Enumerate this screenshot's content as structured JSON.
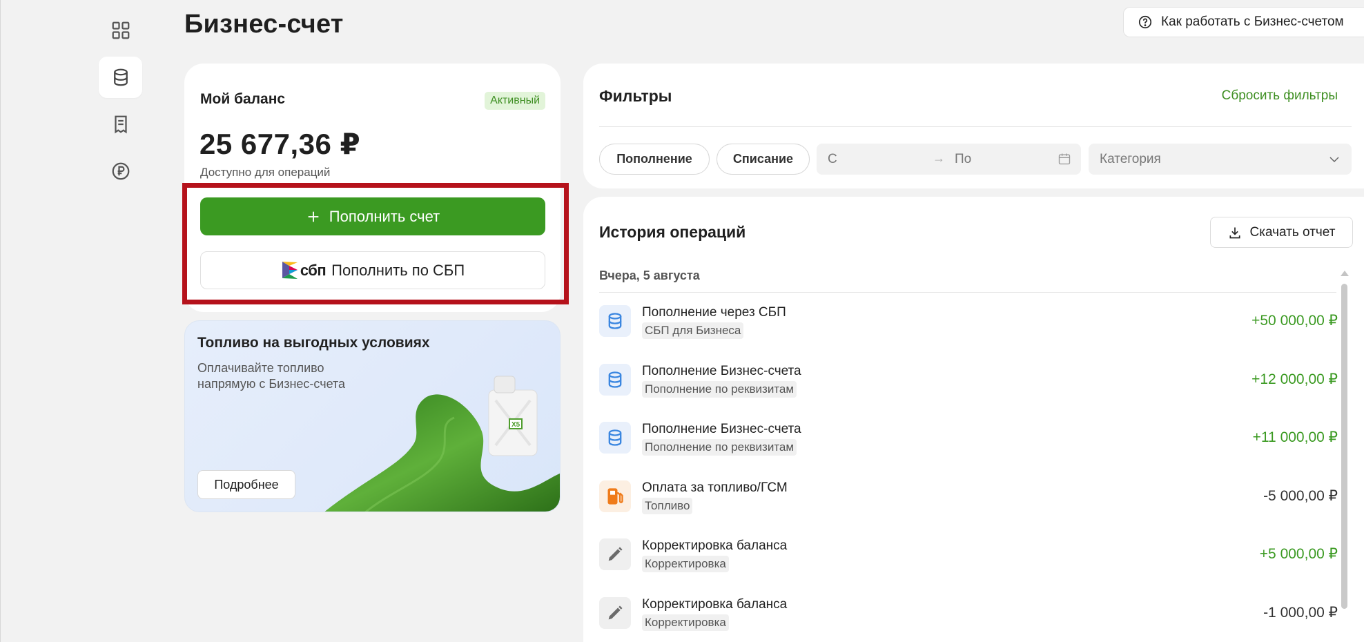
{
  "page": {
    "title": "Бизнес-счет",
    "help_button": "Как работать с Бизнес-счетом"
  },
  "sidebar": {
    "items": [
      {
        "icon": "dashboard-icon",
        "active": false
      },
      {
        "icon": "database-icon",
        "active": true
      },
      {
        "icon": "receipt-icon",
        "active": false
      },
      {
        "icon": "ruble-icon",
        "active": false
      }
    ]
  },
  "balance": {
    "label": "Мой баланс",
    "status": "Активный",
    "amount": "25 677,36 ₽",
    "subtitle": "Доступно для операций",
    "topup_button": "Пополнить счет",
    "sbp_logo_text": "сбп",
    "sbp_button": "Пополнить по СБП"
  },
  "promo": {
    "title": "Топливо на выгодных условиях",
    "text": "Оплачивайте топливо напрямую с Бизнес-счета",
    "button": "Подробнее",
    "canister_mark": "X5"
  },
  "filters": {
    "title": "Фильтры",
    "reset": "Сбросить фильтры",
    "chip_topup": "Пополнение",
    "chip_writeoff": "Списание",
    "date_from": "С",
    "date_to": "По",
    "category": "Категория"
  },
  "history": {
    "title": "История операций",
    "download": "Скачать отчет",
    "date_group": "Вчера, 5 августа",
    "transactions": [
      {
        "title": "Пополнение через СБП",
        "tag": "СБП для Бизнеса",
        "amount": "+50 000,00 ₽",
        "icon": "database-icon"
      },
      {
        "title": "Пополнение Бизнес-счета",
        "tag": "Пополнение по реквизитам",
        "amount": "+12 000,00 ₽",
        "icon": "database-icon"
      },
      {
        "title": "Пополнение Бизнес-счета",
        "tag": "Пополнение по реквизитам",
        "amount": "+11 000,00 ₽",
        "icon": "database-icon"
      },
      {
        "title": "Оплата за топливо/ГСМ",
        "tag": "Топливо",
        "amount": "-5 000,00 ₽",
        "icon": "fuel-pump-icon"
      },
      {
        "title": "Корректировка баланса",
        "tag": "Корректировка",
        "amount": "+5 000,00 ₽",
        "icon": "pencil-icon"
      },
      {
        "title": "Корректировка баланса",
        "tag": "Корректировка",
        "amount": "-1 000,00 ₽",
        "icon": "pencil-icon"
      }
    ]
  },
  "colors": {
    "accent_green": "#3b9a22",
    "highlight_red": "#b5121b",
    "negative_text": "#333333"
  }
}
